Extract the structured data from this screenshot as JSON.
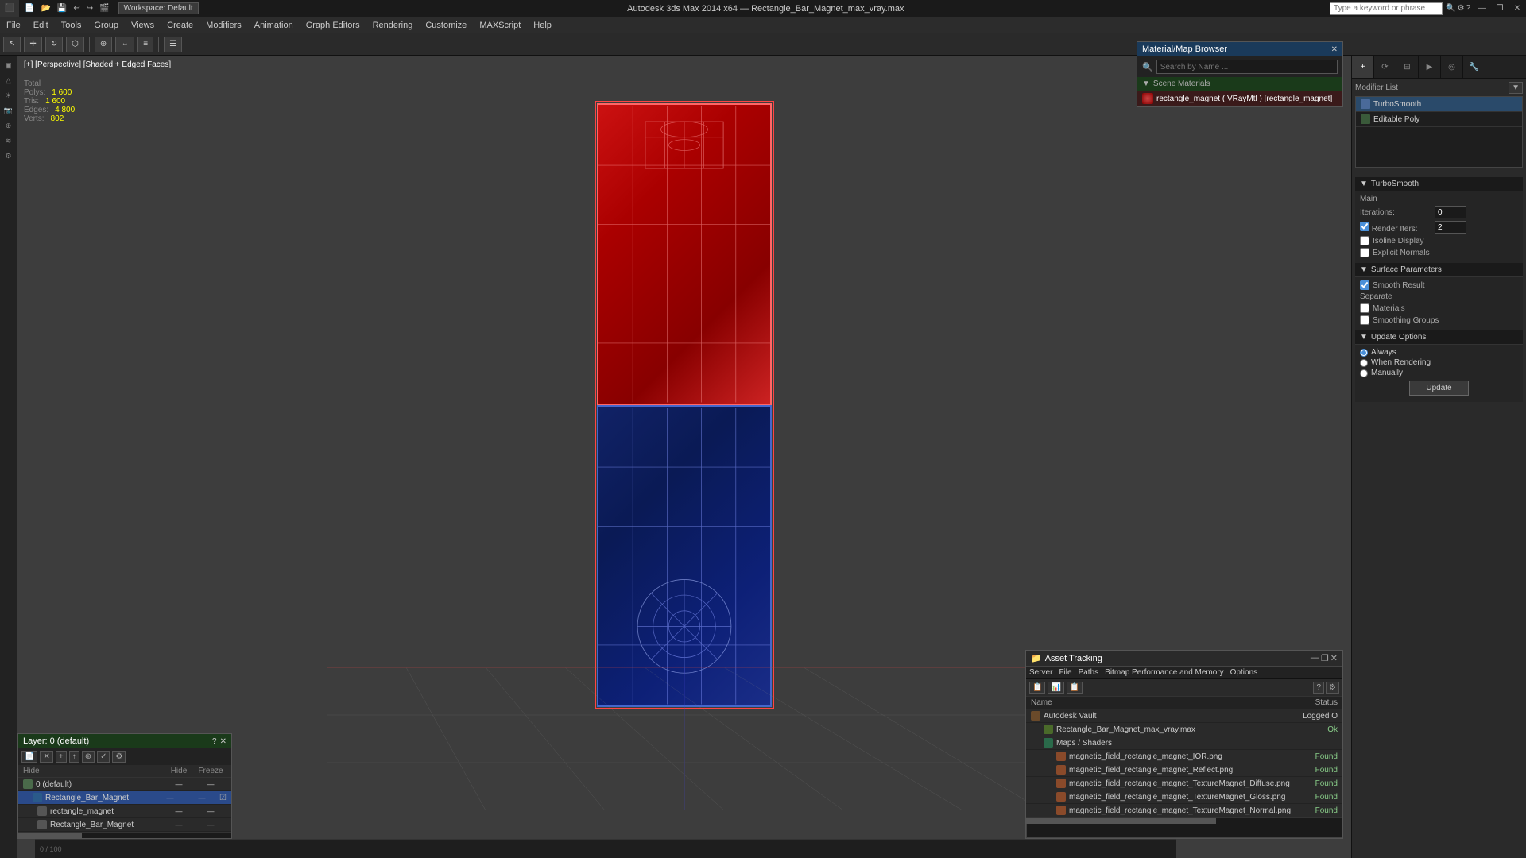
{
  "app": {
    "title": "Autodesk 3ds Max 2014 x64",
    "file": "Rectangle_Bar_Magnet_max_vray.max",
    "workspace": "Workspace: Default"
  },
  "titlebar": {
    "search_placeholder": "Type a keyword or phrase",
    "win_minimize": "—",
    "win_restore": "❐",
    "win_close": "✕"
  },
  "menubar": {
    "items": [
      "Edit",
      "Tools",
      "Group",
      "Views",
      "Create",
      "Modifiers",
      "Animation",
      "Graph Editors",
      "Rendering",
      "Customize",
      "MAXScript",
      "Help"
    ]
  },
  "viewport": {
    "label": "[+] [Perspective] [Shaded + Edged Faces]",
    "stats": {
      "polys_label": "Polys:",
      "polys_value": "1 600",
      "tris_label": "Tris:",
      "tris_value": "1 600",
      "edges_label": "Edges:",
      "edges_value": "4 800",
      "verts_label": "Verts:",
      "verts_value": "802"
    }
  },
  "mat_browser": {
    "title": "Material/Map Browser",
    "search_placeholder": "Search by Name ...",
    "scene_materials_label": "Scene Materials",
    "material_item": "rectangle_magnet  ( VRayMtl )  [rectangle_magnet]"
  },
  "right_panel": {
    "modifier_list_label": "Modifier List",
    "modifiers": [
      "TurboSmooth",
      "Editable Poly"
    ],
    "turbosmooth": {
      "section": "TurboSmooth",
      "main_label": "Main",
      "iterations_label": "Iterations:",
      "iterations_value": "0",
      "render_iters_label": "Render Iters:",
      "render_iters_value": "2",
      "isoline_label": "Isoline Display",
      "explicit_label": "Explicit Normals",
      "surface_params_label": "Surface Parameters",
      "smooth_result_label": "Smooth Result",
      "separate_label": "Separate",
      "materials_label": "Materials",
      "smoothing_groups_label": "Smoothing Groups",
      "update_options_label": "Update Options",
      "always_label": "Always",
      "when_rendering_label": "When Rendering",
      "manually_label": "Manually",
      "update_btn_label": "Update"
    }
  },
  "layers_panel": {
    "title": "Layer: 0 (default)",
    "col_hide": "Hide",
    "col_freeze": "Freeze",
    "layers": [
      {
        "name": "0 (default)",
        "level": 0,
        "selected": false
      },
      {
        "name": "Rectangle_Bar_Magnet",
        "level": 1,
        "selected": true
      },
      {
        "name": "rectangle_magnet",
        "level": 2,
        "selected": false
      },
      {
        "name": "Rectangle_Bar_Magnet",
        "level": 2,
        "selected": false
      }
    ]
  },
  "asset_tracking": {
    "title": "Asset Tracking",
    "menu_items": [
      "Server",
      "File",
      "Paths",
      "Bitmap Performance and Memory",
      "Options"
    ],
    "col_name": "Name",
    "col_status": "Status",
    "rows": [
      {
        "name": "Autodesk Vault",
        "level": 0,
        "status": "Logged O",
        "type": "vault"
      },
      {
        "name": "Rectangle_Bar_Magnet_max_vray.max",
        "level": 1,
        "status": "Ok",
        "type": "file"
      },
      {
        "name": "Maps / Shaders",
        "level": 1,
        "status": "",
        "type": "maps"
      },
      {
        "name": "magnetic_field_rectangle_magnet_IOR.png",
        "level": 2,
        "status": "Found",
        "type": "tex"
      },
      {
        "name": "magnetic_field_rectangle_magnet_Reflect.png",
        "level": 2,
        "status": "Found",
        "type": "tex"
      },
      {
        "name": "magnetic_field_rectangle_magnet_TextureMagnet_Diffuse.png",
        "level": 2,
        "status": "Found",
        "type": "tex"
      },
      {
        "name": "magnetic_field_rectangle_magnet_TextureMagnet_Gloss.png",
        "level": 2,
        "status": "Found",
        "type": "tex"
      },
      {
        "name": "magnetic_field_rectangle_magnet_TextureMagnet_Normal.png",
        "level": 2,
        "status": "Found",
        "type": "tex"
      }
    ]
  }
}
